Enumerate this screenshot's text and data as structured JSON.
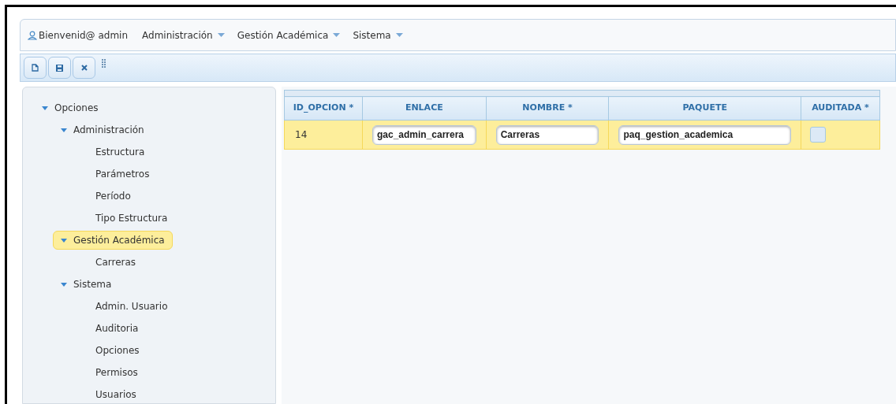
{
  "menubar": {
    "welcome": "Bienvenid@ admin",
    "menus": [
      "Administración",
      "Gestión Académica",
      "Sistema"
    ]
  },
  "toolbar": {
    "buttons": [
      {
        "kind": "new"
      },
      {
        "kind": "save"
      },
      {
        "kind": "delete"
      }
    ]
  },
  "tree": {
    "items": [
      {
        "label": "Opciones",
        "expanded": true,
        "selected": false,
        "children": [
          {
            "label": "Administración",
            "expanded": true,
            "selected": false,
            "children": [
              {
                "label": "Estructura",
                "selected": false
              },
              {
                "label": "Parámetros",
                "selected": false
              },
              {
                "label": "Período",
                "selected": false
              },
              {
                "label": "Tipo Estructura",
                "selected": false
              }
            ]
          },
          {
            "label": "Gestión Académica",
            "expanded": true,
            "selected": true,
            "children": [
              {
                "label": "Carreras",
                "selected": false
              }
            ]
          },
          {
            "label": "Sistema",
            "expanded": true,
            "selected": false,
            "children": [
              {
                "label": "Admin. Usuario",
                "selected": false
              },
              {
                "label": "Auditoria",
                "selected": false
              },
              {
                "label": "Opciones",
                "selected": false
              },
              {
                "label": "Permisos",
                "selected": false
              },
              {
                "label": "Usuarios",
                "selected": false
              }
            ]
          }
        ]
      }
    ]
  },
  "table": {
    "columns": [
      "ID_OPCION *",
      "ENLACE",
      "NOMBRE *",
      "PAQUETE",
      "AUDITADA *"
    ],
    "rows": [
      {
        "selected": true,
        "id_opcion": "14",
        "enlace": "gac_admin_carrera",
        "nombre": "Carreras",
        "paquete": "paq_gestion_academica",
        "auditada": false
      }
    ]
  }
}
